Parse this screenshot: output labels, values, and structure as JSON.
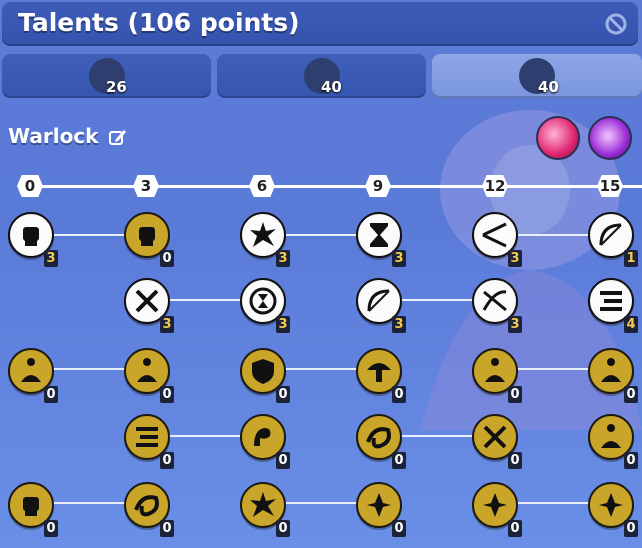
{
  "header": {
    "title": "Talents (106 points)"
  },
  "tabs": [
    {
      "icon": "mage-icon",
      "count": "26"
    },
    {
      "icon": "paladin-icon",
      "count": "40"
    },
    {
      "icon": "warlock-icon",
      "count": "40",
      "active": true
    }
  ],
  "class_name": "Warlock",
  "orbs": [
    "pink-orb-icon",
    "purple-orb-icon"
  ],
  "levels": [
    "0",
    "3",
    "6",
    "9",
    "12",
    "15"
  ],
  "nodes": {
    "r0": [
      "3",
      "0",
      "3",
      "3",
      "3",
      "1"
    ],
    "r1": [
      "3",
      "3",
      "3",
      "3",
      "4"
    ],
    "r2": [
      "0",
      "0",
      "0",
      "0",
      "0",
      "0"
    ],
    "r3": [
      "0",
      "0",
      "0",
      "0",
      "0"
    ],
    "r4": [
      "0",
      "0",
      "0",
      "0",
      "0",
      "0"
    ]
  },
  "colors": {
    "background": "#5a7ad8",
    "gold": "#c9a52a",
    "white": "#fbfbfb"
  }
}
